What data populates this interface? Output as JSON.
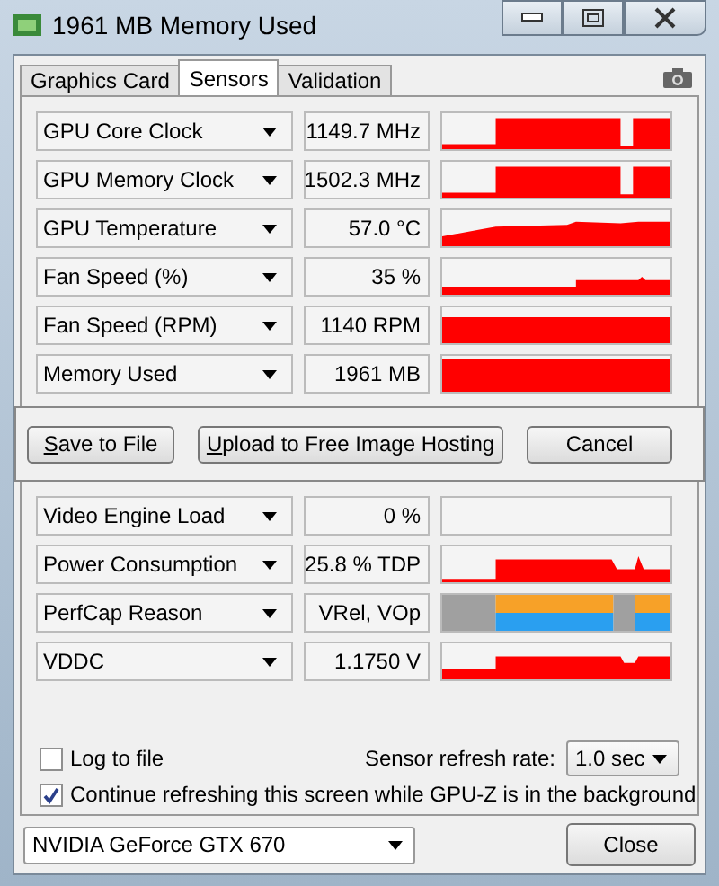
{
  "window": {
    "title": "1961 MB Memory Used"
  },
  "tabs": [
    {
      "label": "Graphics Card",
      "selected": false
    },
    {
      "label": "Sensors",
      "selected": true
    },
    {
      "label": "Validation",
      "selected": false
    }
  ],
  "sensors_top": [
    {
      "name": "GPU Core Clock",
      "value": "1149.7 MHz",
      "kind": "line"
    },
    {
      "name": "GPU Memory Clock",
      "value": "1502.3 MHz",
      "kind": "line"
    },
    {
      "name": "GPU Temperature",
      "value": "57.0 °C",
      "kind": "line"
    },
    {
      "name": "Fan Speed (%)",
      "value": "35 %",
      "kind": "line"
    },
    {
      "name": "Fan Speed (RPM)",
      "value": "1140 RPM",
      "kind": "line"
    },
    {
      "name": "Memory Used",
      "value": "1961 MB",
      "kind": "line"
    }
  ],
  "actions": [
    "Save to File",
    "Upload to Free Image Hosting",
    "Cancel"
  ],
  "sensors_bottom": [
    {
      "name": "Video Engine Load",
      "value": "0 %",
      "kind": "empty"
    },
    {
      "name": "Power Consumption",
      "value": "25.8 % TDP",
      "kind": "line"
    },
    {
      "name": "PerfCap Reason",
      "value": "VRel, VOp",
      "kind": "perfcap"
    },
    {
      "name": "VDDC",
      "value": "1.1750 V",
      "kind": "line"
    }
  ],
  "log_to_file": {
    "label": "Log to file",
    "checked": false
  },
  "refresh_rate": {
    "label": "Sensor refresh rate:",
    "value": "1.0 sec"
  },
  "background_refresh": {
    "label": "Continue refreshing this screen while GPU-Z is in the background",
    "checked": true
  },
  "gpu_select": {
    "value": "NVIDIA GeForce GTX 670"
  },
  "close_button": "Close"
}
